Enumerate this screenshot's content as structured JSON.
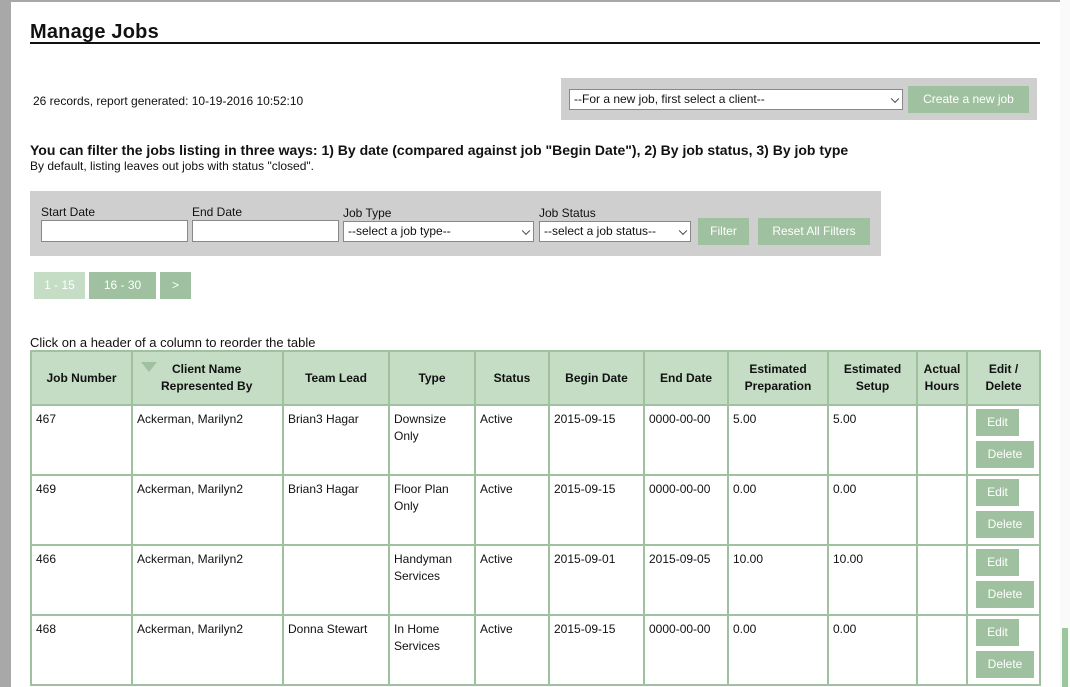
{
  "page": {
    "title": "Manage Jobs"
  },
  "report": {
    "records_text": "26 records, report generated: 10-19-2016 10:52:10"
  },
  "new_job": {
    "client_placeholder": "--For a new job, first select a client--",
    "create_label": "Create a new job"
  },
  "filters": {
    "intro": "You can filter the jobs listing in three ways: 1) By date (compared against job \"Begin Date\"), 2) By job status, 3) By job type",
    "note": "By default, listing leaves out jobs with status \"closed\".",
    "start_date_label": "Start Date",
    "end_date_label": "End Date",
    "job_type_label": "Job Type",
    "job_status_label": "Job Status",
    "job_type_value": "--select a job type--",
    "job_status_value": "--select a job status--",
    "start_date_value": "",
    "end_date_value": "",
    "filter_label": "Filter",
    "reset_label": "Reset All Filters"
  },
  "pagination": {
    "page1": "1 - 15",
    "page2": "16  - 30",
    "next": ">"
  },
  "table": {
    "hint": "Click on a header of a column to reorder the table",
    "headers": {
      "job_number": "Job Number",
      "client_line1": "Client Name",
      "client_line2": "Represented By",
      "team_lead": "Team Lead",
      "type": "Type",
      "status": "Status",
      "begin_date": "Begin Date",
      "end_date": "End Date",
      "est_prep_line1": "Estimated",
      "est_prep_line2": "Preparation",
      "est_setup_line1": "Estimated",
      "est_setup_line2": "Setup",
      "actual_line1": "Actual",
      "actual_line2": "Hours",
      "edit_line1": "Edit /",
      "edit_line2": "Delete"
    },
    "edit_label": "Edit",
    "delete_label": "Delete",
    "rows": [
      {
        "job": "467",
        "client": "Ackerman,  Marilyn2",
        "lead": "Brian3 Hagar",
        "type1": "Downsize",
        "type2": "Only",
        "status": "Active",
        "begin": "2015-09-15",
        "end": "0000-00-00",
        "prep": "5.00",
        "setup": "5.00",
        "actual": ""
      },
      {
        "job": "469",
        "client": "Ackerman,  Marilyn2",
        "lead": "Brian3 Hagar",
        "type1": "Floor Plan",
        "type2": "Only",
        "status": "Active",
        "begin": "2015-09-15",
        "end": "0000-00-00",
        "prep": "0.00",
        "setup": "0.00",
        "actual": ""
      },
      {
        "job": "466",
        "client": "Ackerman,  Marilyn2",
        "lead": "",
        "type1": "Handyman",
        "type2": "Services",
        "status": "Active",
        "begin": "2015-09-01",
        "end": "2015-09-05",
        "prep": "10.00",
        "setup": "10.00",
        "actual": ""
      },
      {
        "job": "468",
        "client": "Ackerman,  Marilyn2",
        "lead": "Donna Stewart",
        "type1": "In Home",
        "type2": "Services",
        "status": "Active",
        "begin": "2015-09-15",
        "end": "0000-00-00",
        "prep": "0.00",
        "setup": "0.00",
        "actual": ""
      }
    ]
  },
  "colors": {
    "accent_green": "#9fc19f",
    "header_green": "#c5dcc5",
    "panel_gray": "#cfcfcf",
    "backdrop": "#a8a8a8"
  }
}
